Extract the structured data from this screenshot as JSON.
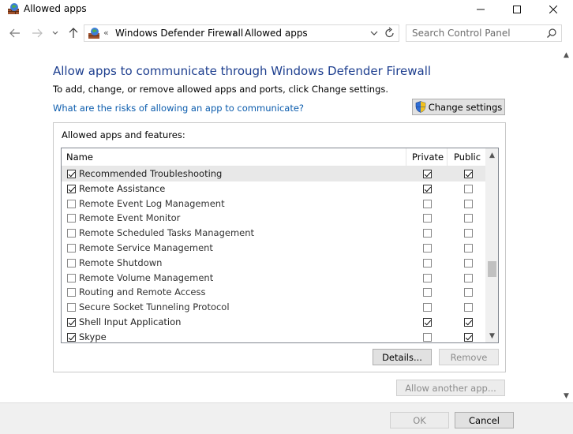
{
  "window": {
    "title": "Allowed apps",
    "icon": "firewall-icon",
    "controls": [
      "minimize-icon",
      "maximize-icon",
      "close-icon"
    ]
  },
  "nav": {
    "address_chevron": "«",
    "breadcrumbs": [
      "Windows Defender Firewall",
      "Allowed apps"
    ],
    "breadcrumb_separator": "›",
    "search_placeholder": "Search Control Panel"
  },
  "main": {
    "title": "Allow apps to communicate through Windows Defender Firewall",
    "subtitle": "To add, change, or remove allowed apps and ports, click Change settings.",
    "risk_link": "What are the risks of allowing an app to communicate?",
    "change_settings_label": "Change settings"
  },
  "apps_group": {
    "label": "Allowed apps and features:",
    "columns": {
      "name": "Name",
      "private": "Private",
      "public": "Public"
    },
    "rows": [
      {
        "name": "Recommended Troubleshooting",
        "enabled": true,
        "private": true,
        "public": true,
        "selected": true
      },
      {
        "name": "Remote Assistance",
        "enabled": true,
        "private": true,
        "public": false
      },
      {
        "name": "Remote Event Log Management",
        "enabled": false,
        "private": false,
        "public": false
      },
      {
        "name": "Remote Event Monitor",
        "enabled": false,
        "private": false,
        "public": false
      },
      {
        "name": "Remote Scheduled Tasks Management",
        "enabled": false,
        "private": false,
        "public": false
      },
      {
        "name": "Remote Service Management",
        "enabled": false,
        "private": false,
        "public": false
      },
      {
        "name": "Remote Shutdown",
        "enabled": false,
        "private": false,
        "public": false
      },
      {
        "name": "Remote Volume Management",
        "enabled": false,
        "private": false,
        "public": false
      },
      {
        "name": "Routing and Remote Access",
        "enabled": false,
        "private": false,
        "public": false
      },
      {
        "name": "Secure Socket Tunneling Protocol",
        "enabled": false,
        "private": false,
        "public": false
      },
      {
        "name": "Shell Input Application",
        "enabled": true,
        "private": true,
        "public": true
      },
      {
        "name": "Skype",
        "enabled": true,
        "private": false,
        "public": true
      }
    ],
    "details_label": "Details...",
    "remove_label": "Remove"
  },
  "allow_another_label": "Allow another app...",
  "footer": {
    "ok_label": "OK",
    "cancel_label": "Cancel"
  },
  "colors": {
    "title_blue": "#1e3f8f",
    "link_blue": "#0b5cad",
    "button_face": "#e1e1e1",
    "footer_bg": "#f0f0f0"
  }
}
